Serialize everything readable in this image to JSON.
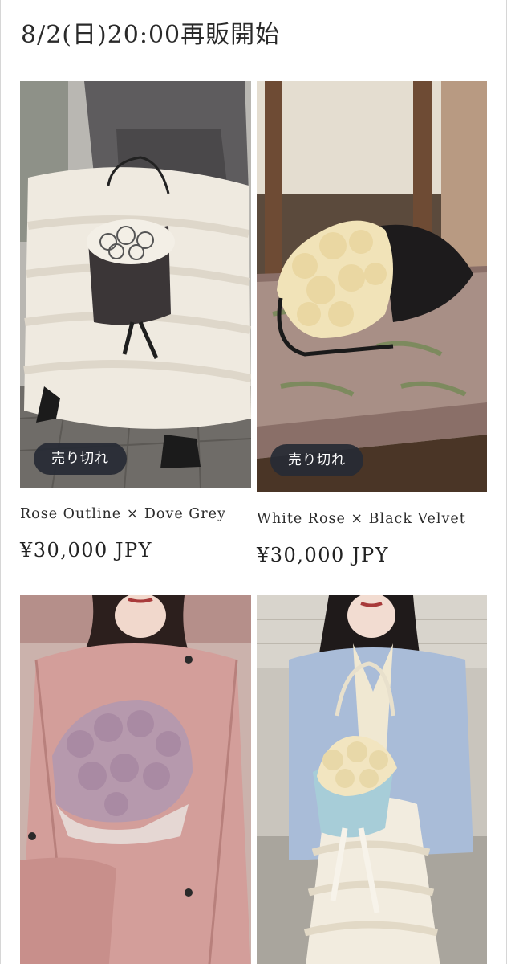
{
  "heading": "8/2(日)20:00再販開始",
  "products": [
    {
      "name": "Rose Outline × Dove Grey",
      "price": "¥30,000 JPY",
      "badge": "売り切れ"
    },
    {
      "name": "White Rose × Black Velvet",
      "price": "¥30,000 JPY",
      "badge": "売り切れ"
    },
    {
      "name": "",
      "price": "",
      "badge": ""
    },
    {
      "name": "",
      "price": "",
      "badge": ""
    }
  ],
  "colors": {
    "badge_background": "#262a34",
    "text": "#222222",
    "page_background": "#ffffff"
  }
}
